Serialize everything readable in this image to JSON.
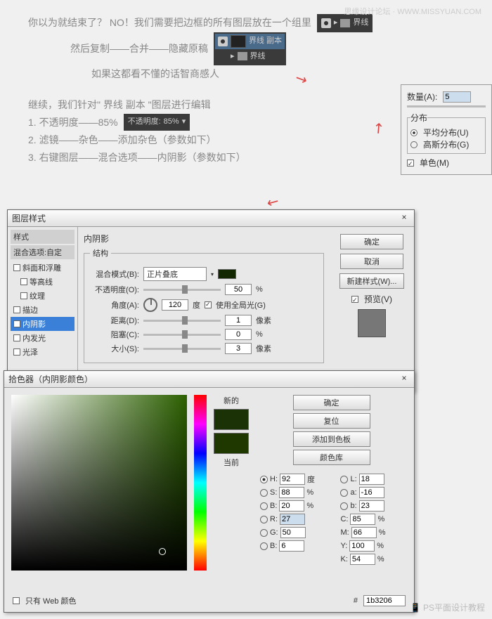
{
  "watermark": "思缘设计论坛 · WWW.MISSYUAN.COM",
  "tutorial": {
    "line1a": "你以为就结束了？ NO！我们需要把边框的所有图层放在一个组里",
    "line2": "然后复制——合并——隐藏原稿",
    "line3": "如果这都看不懂的话智商感人",
    "layer_copy": "界线 副本",
    "layer_group": "界线",
    "cont_title": "继续，我们针对\" 界线 副本 \"图层进行编辑",
    "step1": "1. 不透明度——85%",
    "step2": "2. 滤镜——杂色——添加杂色（参数如下）",
    "step3": "3. 右键图层——混合选项——内阴影（参数如下）",
    "opacity_label": "不透明度:",
    "opacity_value": "85%"
  },
  "noise": {
    "amount_label": "数量(A):",
    "amount_value": "5",
    "dist_title": "分布",
    "uniform": "平均分布(U)",
    "gaussian": "高斯分布(G)",
    "mono": "单色(M)"
  },
  "ls": {
    "title": "图层样式",
    "close": "×",
    "left_hdr1": "样式",
    "left_hdr2": "混合选项:自定",
    "items": [
      "斜面和浮雕",
      "等高线",
      "纹理",
      "描边",
      "内阴影",
      "内发光",
      "光泽"
    ],
    "section": "内阴影",
    "struct": "结构",
    "blend_mode": "混合模式(B):",
    "blend_val": "正片叠底",
    "opacity": "不透明度(O):",
    "opacity_val": "50",
    "angle": "角度(A):",
    "angle_val": "120",
    "angle_unit": "度",
    "global": "使用全局光(G)",
    "distance": "距离(D):",
    "distance_val": "1",
    "choke": "阻塞(C):",
    "choke_val": "0",
    "size": "大小(S):",
    "size_val": "3",
    "px": "像素",
    "pct": "%",
    "ok": "确定",
    "cancel": "取消",
    "newstyle": "新建样式(W)...",
    "preview": "预览(V)"
  },
  "cp": {
    "title": "拾色器（内阴影颜色）",
    "close": "×",
    "new": "新的",
    "current": "当前",
    "ok": "确定",
    "reset": "复位",
    "addswatch": "添加到色板",
    "colorlib": "颜色库",
    "H": "92",
    "S": "88",
    "Bv": "20",
    "R": "27",
    "G": "50",
    "Bb": "6",
    "L": "18",
    "a": "-16",
    "b": "23",
    "C": "85",
    "M": "66",
    "Y": "100",
    "K": "54",
    "deg": "度",
    "pct": "%",
    "webonly": "只有 Web 颜色",
    "hexlabel": "#",
    "hex": "1b3206"
  },
  "bottom": "PS平面设计教程"
}
